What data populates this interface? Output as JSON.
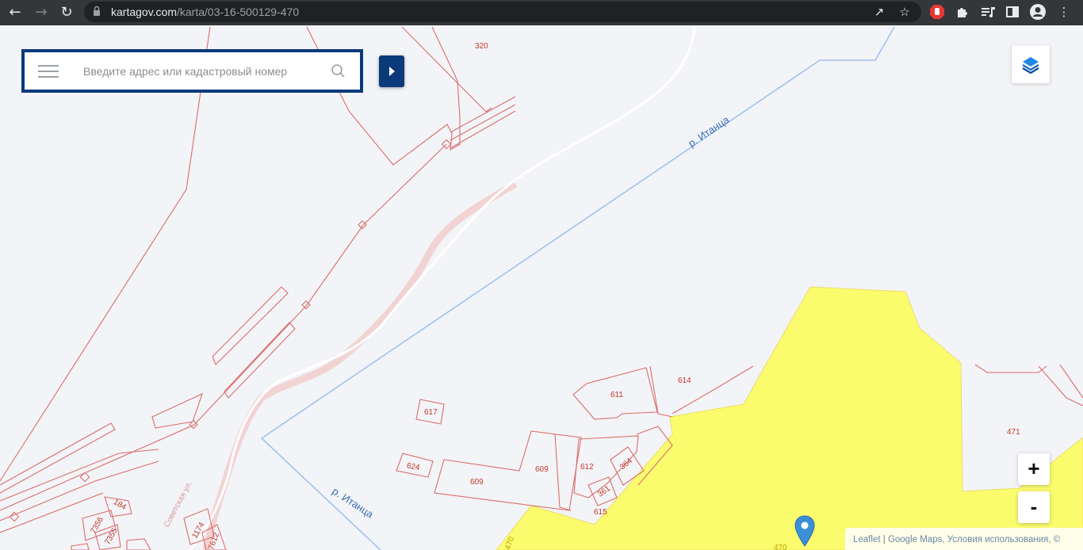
{
  "browser": {
    "url_host": "kartagov.com",
    "url_path": "/karta/03-16-500129-470",
    "icons": [
      "back-arrow-icon",
      "forward-arrow-icon",
      "reload-icon",
      "lock-icon",
      "share-icon",
      "star-icon",
      "adblock-icon",
      "extensions-icon",
      "media-icon",
      "sidepanel-icon",
      "profile-icon",
      "menu-dots-icon"
    ]
  },
  "search": {
    "placeholder": "Введите адрес или кадастровый номер"
  },
  "map": {
    "parcel_labels": [
      "320",
      "611",
      "614",
      "617",
      "609",
      "612",
      "364",
      "361",
      "615",
      "624",
      "609",
      "471",
      "184",
      "7356",
      "7355",
      "1174",
      "7612",
      "470",
      "470"
    ],
    "river_name": "р. Итанца",
    "street_name": "Советская ул.",
    "colors": {
      "parcel_line": "#d96e6e",
      "river": "#9fc2ef",
      "highlight": "#fbfb6e",
      "road": "#f2d3d3",
      "brand": "#0a3a7a",
      "marker": "#3b8fd6"
    }
  },
  "controls": {
    "zoom_in": "+",
    "zoom_out": "-",
    "layers_icon": "layers-icon"
  },
  "attribution": {
    "leaflet": "Leaflet",
    "separator": "|",
    "provider": "Google Maps,",
    "terms": "Условия использования, ©"
  }
}
